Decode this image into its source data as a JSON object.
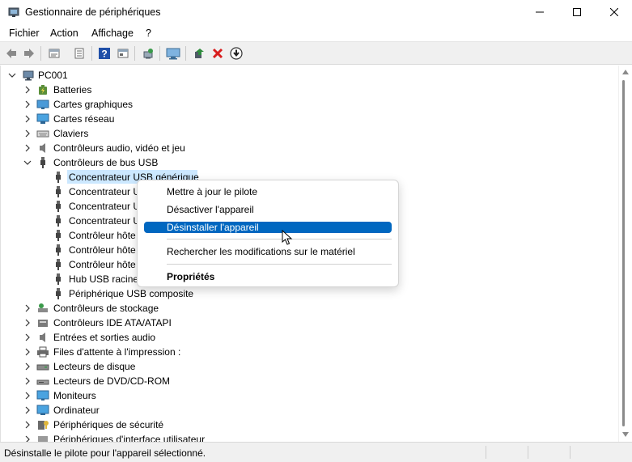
{
  "window": {
    "title": "Gestionnaire de périphériques"
  },
  "menubar": {
    "items": [
      "Fichier",
      "Action",
      "Affichage",
      "?"
    ]
  },
  "toolbar": {
    "icons": [
      "back-arrow-icon",
      "forward-arrow-icon",
      "properties-view-icon",
      "device-list-icon",
      "help-icon",
      "show-hidden-icon",
      "scan-hardware-icon",
      "monitor-icon",
      "update-driver-icon",
      "uninstall-icon",
      "download-icon"
    ]
  },
  "tree": {
    "root": "PC001",
    "categories": [
      {
        "label": "Batteries",
        "icon": "battery-icon",
        "expanded": false
      },
      {
        "label": "Cartes graphiques",
        "icon": "display-adapter-icon",
        "expanded": false
      },
      {
        "label": "Cartes réseau",
        "icon": "network-adapter-icon",
        "expanded": false
      },
      {
        "label": "Claviers",
        "icon": "keyboard-icon",
        "expanded": false
      },
      {
        "label": "Contrôleurs audio, vidéo et jeu",
        "icon": "speaker-icon",
        "expanded": false
      },
      {
        "label": "Contrôleurs de bus USB",
        "icon": "usb-icon",
        "expanded": true
      },
      {
        "label": "Contrôleurs de stockage",
        "icon": "storage-controller-icon",
        "expanded": false
      },
      {
        "label": "Contrôleurs IDE ATA/ATAPI",
        "icon": "ide-controller-icon",
        "expanded": false
      },
      {
        "label": "Entrées et sorties audio",
        "icon": "speaker-icon",
        "expanded": false
      },
      {
        "label": "Files d'attente à l'impression :",
        "icon": "printer-icon",
        "expanded": false
      },
      {
        "label": "Lecteurs de disque",
        "icon": "disk-drive-icon",
        "expanded": false
      },
      {
        "label": "Lecteurs de DVD/CD-ROM",
        "icon": "dvd-drive-icon",
        "expanded": false
      },
      {
        "label": "Moniteurs",
        "icon": "monitor-icon",
        "expanded": false
      },
      {
        "label": "Ordinateur",
        "icon": "computer-icon",
        "expanded": false
      },
      {
        "label": "Périphériques de sécurité",
        "icon": "security-device-icon",
        "expanded": false
      },
      {
        "label": "Périphériques d'interface utilisateur",
        "icon": "hid-icon",
        "expanded": false
      }
    ],
    "usb_children": [
      "Concentrateur USB générique",
      "Concentrateur U",
      "Concentrateur U",
      "Concentrateur U",
      "Contrôleur hôte",
      "Contrôleur hôte",
      "Contrôleur hôte",
      "Hub USB racine",
      "Périphérique USB composite"
    ]
  },
  "context_menu": {
    "items": [
      {
        "label": "Mettre à jour le pilote",
        "highlighted": false,
        "bold": false
      },
      {
        "label": "Désactiver l'appareil",
        "highlighted": false,
        "bold": false
      },
      {
        "label": "Désinstaller l'appareil",
        "highlighted": true,
        "bold": false
      },
      {
        "label": "Rechercher les modifications sur le matériel",
        "highlighted": false,
        "bold": false
      },
      {
        "label": "Propriétés",
        "highlighted": false,
        "bold": true
      }
    ]
  },
  "statusbar": {
    "text": "Désinstalle le pilote pour l'appareil sélectionné."
  },
  "colors": {
    "highlight": "#0067c0",
    "selection": "#cce8ff",
    "uninstall_red": "#d81e1e",
    "update_green": "#2e8b3d"
  }
}
